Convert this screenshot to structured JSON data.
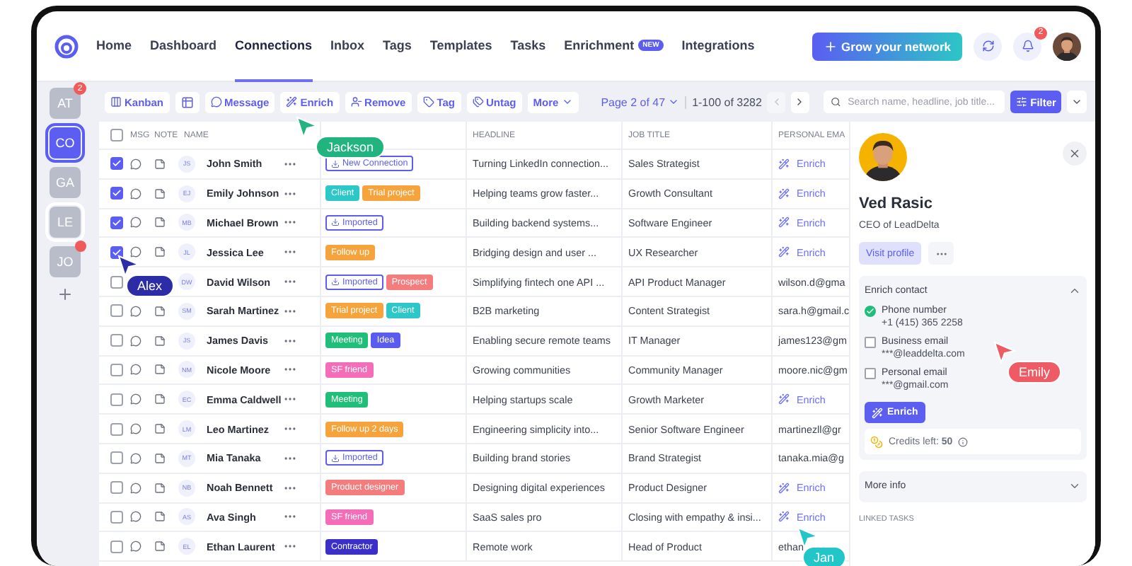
{
  "nav": {
    "items": [
      {
        "label": "Home",
        "selected": false
      },
      {
        "label": "Dashboard",
        "selected": false
      },
      {
        "label": "Connections",
        "selected": true
      },
      {
        "label": "Inbox",
        "selected": false
      },
      {
        "label": "Tags",
        "selected": false
      },
      {
        "label": "Templates",
        "selected": false
      },
      {
        "label": "Tasks",
        "selected": false
      },
      {
        "label": "Enrichment",
        "selected": false,
        "badge": "NEW"
      },
      {
        "label": "Integrations",
        "selected": false
      }
    ],
    "cta": "Grow your network",
    "notifications": "2"
  },
  "rail": [
    {
      "initials": "AT",
      "selected": false,
      "badge": "2"
    },
    {
      "initials": "CO",
      "selected": true
    },
    {
      "initials": "GA",
      "selected": false
    },
    {
      "initials": "LE",
      "selected": false,
      "outlined": true
    },
    {
      "initials": "JO",
      "selected": false,
      "alert": true
    }
  ],
  "toolbar": {
    "actions": [
      {
        "kind": "text",
        "label": "Kanban"
      },
      {
        "kind": "icon"
      },
      {
        "kind": "text",
        "label": "Message"
      },
      {
        "kind": "text",
        "label": "Enrich"
      },
      {
        "kind": "text",
        "label": "Remove"
      },
      {
        "kind": "text",
        "label": "Tag"
      },
      {
        "kind": "text",
        "label": "Untag"
      },
      {
        "kind": "menu",
        "label": "More"
      }
    ],
    "page": "Page 2 of 47",
    "range": "1-100 of 3282",
    "search": {
      "placeholder": "Search name, headline, job title..."
    },
    "filter": "Filter"
  },
  "table": {
    "select_all_checked": false,
    "columns": [
      "MSG",
      "NOTE",
      "NAME",
      "HEADLINE",
      "JOB TITLE",
      "PERSONAL EMA"
    ],
    "rows": [
      {
        "checked": true,
        "initials": "JS",
        "name": "John Smith",
        "tags": [
          {
            "label": "New Connection",
            "kind": "outline",
            "color": "#5b5ef0"
          }
        ],
        "headline": "Turning LinkedIn connection...",
        "job_title": "Sales Strategist",
        "email": {
          "kind": "enrich",
          "text": "Enrich"
        }
      },
      {
        "checked": true,
        "initials": "EJ",
        "name": "Emily Johnson",
        "tags": [
          {
            "label": "Client",
            "kind": "solid",
            "color": "#2cc7c7"
          },
          {
            "label": "Trial project",
            "kind": "solid",
            "color": "#f6a33c"
          }
        ],
        "headline": "Helping teams grow faster...",
        "job_title": "Growth Consultant",
        "email": {
          "kind": "enrich",
          "text": "Enrich"
        }
      },
      {
        "checked": true,
        "initials": "MB",
        "name": "Michael Brown",
        "tags": [
          {
            "label": "Imported",
            "kind": "outline",
            "color": "#5b5ef0"
          }
        ],
        "headline": "Building backend systems...",
        "job_title": "Software Engineer",
        "email": {
          "kind": "enrich",
          "text": "Enrich"
        }
      },
      {
        "checked": true,
        "initials": "JL",
        "name": "Jessica Lee",
        "tags": [
          {
            "label": "Follow up",
            "kind": "solid",
            "color": "#f6a33c"
          }
        ],
        "headline": "Bridging design and user ...",
        "job_title": "UX Researcher",
        "email": {
          "kind": "enrich",
          "text": "Enrich"
        }
      },
      {
        "checked": false,
        "initials": "DW",
        "name": "David Wilson",
        "tags": [
          {
            "label": "Imported",
            "kind": "outline",
            "color": "#5b5ef0"
          },
          {
            "label": "Prospect",
            "kind": "solid",
            "color": "#f47c7c"
          }
        ],
        "headline": "Simplifying fintech one API ...",
        "job_title": "API Product Manager",
        "email": {
          "kind": "text",
          "text": "wilson.d@gma"
        }
      },
      {
        "checked": false,
        "initials": "SM",
        "name": "Sarah Martinez",
        "tags": [
          {
            "label": "Trial project",
            "kind": "solid",
            "color": "#f6a33c"
          },
          {
            "label": "Client",
            "kind": "solid",
            "color": "#2cc7c7"
          }
        ],
        "headline": "B2B marketing",
        "job_title": "Content Strategist",
        "email": {
          "kind": "text",
          "text": "sara.h@gmail.c"
        }
      },
      {
        "checked": false,
        "initials": "JS",
        "name": "James Davis",
        "tags": [
          {
            "label": "Meeting",
            "kind": "solid",
            "color": "#1fbf7a"
          },
          {
            "label": "Idea",
            "kind": "solid",
            "color": "#5a5cf0"
          }
        ],
        "headline": "Enabling secure remote teams",
        "job_title": "IT Manager",
        "email": {
          "kind": "text",
          "text": "james123@gm"
        }
      },
      {
        "checked": false,
        "initials": "NM",
        "name": "Nicole Moore",
        "tags": [
          {
            "label": "SF friend",
            "kind": "solid",
            "color": "#f56cb8"
          }
        ],
        "headline": "Growing communities",
        "job_title": "Community Manager",
        "email": {
          "kind": "text",
          "text": "moore.nic@gm"
        }
      },
      {
        "checked": false,
        "initials": "EC",
        "name": "Emma Caldwell",
        "tags": [
          {
            "label": "Meeting",
            "kind": "solid",
            "color": "#1fbf7a"
          }
        ],
        "headline": "Helping startups scale",
        "job_title": "Growth Marketer",
        "email": {
          "kind": "enrich",
          "text": "Enrich"
        }
      },
      {
        "checked": false,
        "initials": "LM",
        "name": "Leo Martinez",
        "tags": [
          {
            "label": "Follow up 2 days",
            "kind": "solid",
            "color": "#f6a33c"
          }
        ],
        "headline": "Engineering simplicity into...",
        "job_title": "Senior Software Engineer",
        "email": {
          "kind": "text",
          "text": "martinezll@gr"
        }
      },
      {
        "checked": false,
        "initials": "MT",
        "name": "Mia Tanaka",
        "tags": [
          {
            "label": "Imported",
            "kind": "outline",
            "color": "#5b5ef0"
          }
        ],
        "headline": "Building brand stories",
        "job_title": "Brand Strategist",
        "email": {
          "kind": "text",
          "text": "tanaka.mia@g"
        }
      },
      {
        "checked": false,
        "initials": "NB",
        "name": "Noah Bennett",
        "tags": [
          {
            "label": "Product designer",
            "kind": "solid",
            "color": "#f47c7c"
          }
        ],
        "headline": "Designing digital experiences",
        "job_title": "Product Designer",
        "email": {
          "kind": "enrich",
          "text": "Enrich"
        }
      },
      {
        "checked": false,
        "initials": "AS",
        "name": "Ava Singh",
        "tags": [
          {
            "label": "SF friend",
            "kind": "solid",
            "color": "#f56cb8"
          }
        ],
        "headline": "SaaS sales pro",
        "job_title": "Closing with empathy & insi...",
        "email": {
          "kind": "enrich",
          "text": "Enrich"
        }
      },
      {
        "checked": false,
        "initials": "EL",
        "name": "Ethan Laurent",
        "tags": [
          {
            "label": "Contractor",
            "kind": "solid",
            "color": "#3a2fc8"
          }
        ],
        "headline": "Remote work",
        "job_title": "Head of Product",
        "email": {
          "kind": "text",
          "text": "ethan"
        }
      }
    ]
  },
  "panel": {
    "name": "Ved Rasic",
    "title": "CEO of LeadDelta",
    "visit": "Visit profile",
    "enrich": {
      "title": "Enrich contact",
      "expanded": true,
      "items": [
        {
          "label": "Phone number",
          "value": "+1 (415) 365 2258",
          "checked": true
        },
        {
          "label": "Business email",
          "value": "***@leaddelta.com",
          "checked": false
        },
        {
          "label": "Personal email",
          "value": "***@gmail.com",
          "checked": false
        }
      ],
      "button": "Enrich",
      "credits": "Credits left: **50**"
    },
    "more": {
      "title": "More info",
      "expanded": false
    },
    "linked": "LINKED TASKS"
  },
  "cursors": [
    {
      "name": "Jackson",
      "color": "#22b47f"
    },
    {
      "name": "Alex",
      "color": "#2b2ca6"
    },
    {
      "name": "Emily",
      "color": "#ef5b64"
    },
    {
      "name": "Jan",
      "color": "#22c6c9"
    }
  ]
}
